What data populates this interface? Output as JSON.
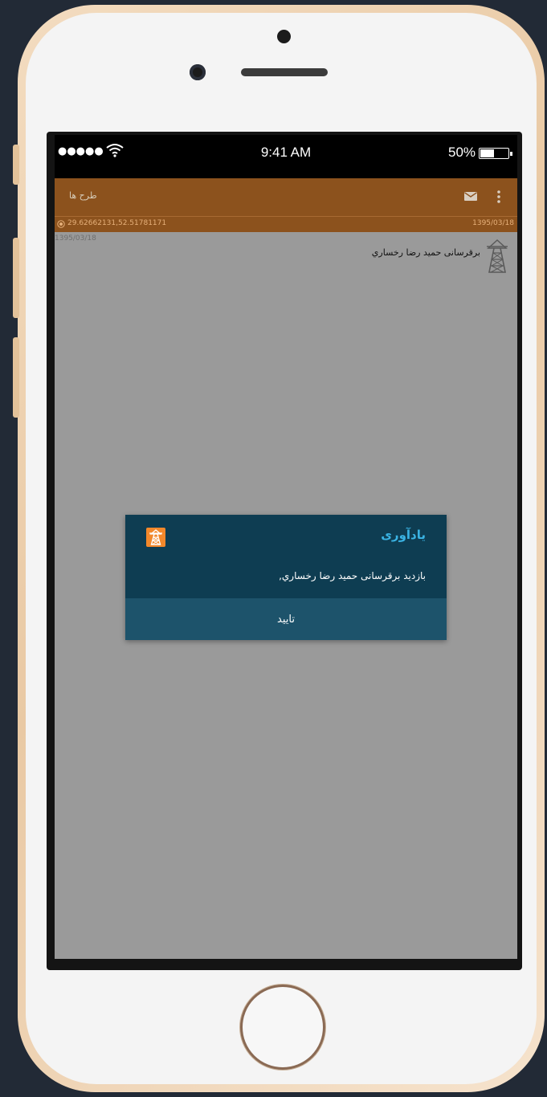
{
  "status_bar": {
    "signal_dots": "●●●●●",
    "time": "9:41 AM",
    "battery_percent": "50%",
    "battery_level": 0.5
  },
  "app_bar": {
    "title": "طرح ها",
    "mail_icon": "envelope-icon",
    "menu_icon": "more-vertical-icon"
  },
  "location_bar": {
    "icon": "location-pin-icon",
    "coordinates": "29.62662131,52.51781171",
    "date": "1395/03/18"
  },
  "list": {
    "items": [
      {
        "date": "1395/03/18",
        "title": "برقرسانی حمید رضا رخساري",
        "icon": "power-tower-icon"
      }
    ]
  },
  "dialog": {
    "title": "یادآوری",
    "message": "بازدید برقرسانی حمید رضا رخساري,",
    "confirm_label": "تایید",
    "icon": "power-tower-icon"
  },
  "colors": {
    "app_bar": "#8c521d",
    "dialog_bg": "#0e3d52",
    "dialog_button": "#1d536b",
    "dialog_title": "#3ab3e3",
    "overlay": "#9a9a9a"
  }
}
